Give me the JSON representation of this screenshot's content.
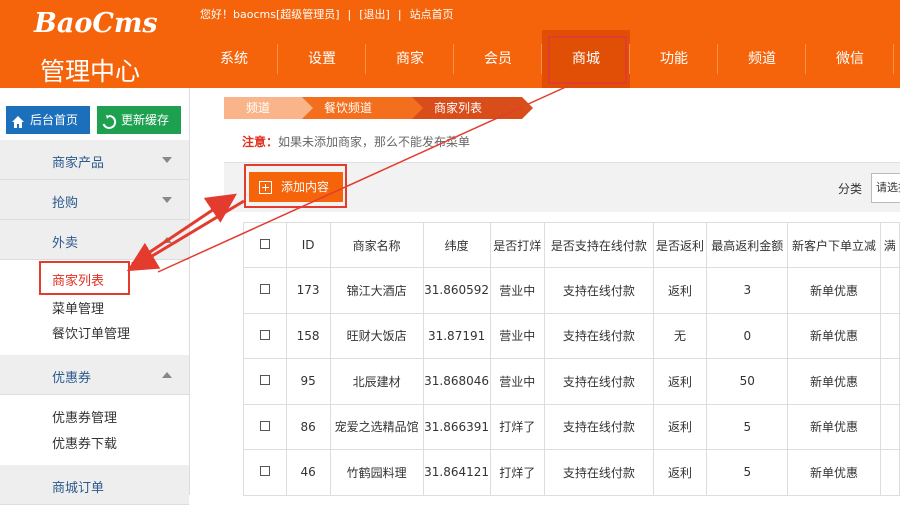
{
  "header": {
    "logo_text": "BaoCms",
    "logo_sub": "管理中心",
    "greeting": "您好！baocms[超级管理员]",
    "sep1": "|",
    "logout": "[退出]",
    "sep2": "|",
    "site_home": "站点首页"
  },
  "nav": [
    "系统",
    "设置",
    "商家",
    "会员",
    "商城",
    "功能",
    "频道",
    "微信"
  ],
  "sidebar": {
    "home_btn": "后台首页",
    "cache_btn": "更新缓存",
    "sections": [
      {
        "label": "商家产品"
      },
      {
        "label": "抢购"
      },
      {
        "label": "外卖"
      },
      {
        "label": "优惠券"
      },
      {
        "label": "商城订单"
      }
    ],
    "takeout_items": [
      "商家列表",
      "菜单管理",
      "餐饮订单管理"
    ],
    "coupon_items": [
      "优惠券管理",
      "优惠券下载"
    ]
  },
  "breadcrumb": [
    "频道",
    "餐饮频道",
    "商家列表"
  ],
  "notice": {
    "label": "注意：",
    "text": "如果未添加商家，那么不能发布菜单"
  },
  "toolbar": {
    "add_label": "添加内容",
    "filter_label": "分类",
    "filter_value": "请选择"
  },
  "table": {
    "headers": [
      "",
      "ID",
      "商家名称",
      "纬度",
      "是否打烊",
      "是否支持在线付款",
      "是否返利",
      "最高返利金额",
      "新客户下单立减",
      "满"
    ],
    "rows": [
      [
        "",
        "173",
        "锦江大酒店",
        "31.860592",
        "营业中",
        "支持在线付款",
        "返利",
        "3",
        "新单优惠",
        ""
      ],
      [
        "",
        "158",
        "旺财大饭店",
        "31.87191",
        "营业中",
        "支持在线付款",
        "无",
        "0",
        "新单优惠",
        ""
      ],
      [
        "",
        "95",
        "北辰建材",
        "31.868046",
        "营业中",
        "支持在线付款",
        "返利",
        "50",
        "新单优惠",
        ""
      ],
      [
        "",
        "86",
        "宠爱之选精品馆",
        "31.866391",
        "打烊了",
        "支持在线付款",
        "返利",
        "5",
        "新单优惠",
        ""
      ],
      [
        "",
        "46",
        "竹鹤园料理",
        "31.864121",
        "打烊了",
        "支持在线付款",
        "返利",
        "5",
        "新单优惠",
        ""
      ]
    ]
  },
  "colors": {
    "brand": "#f5640a",
    "annotation": "#e33c2e"
  }
}
